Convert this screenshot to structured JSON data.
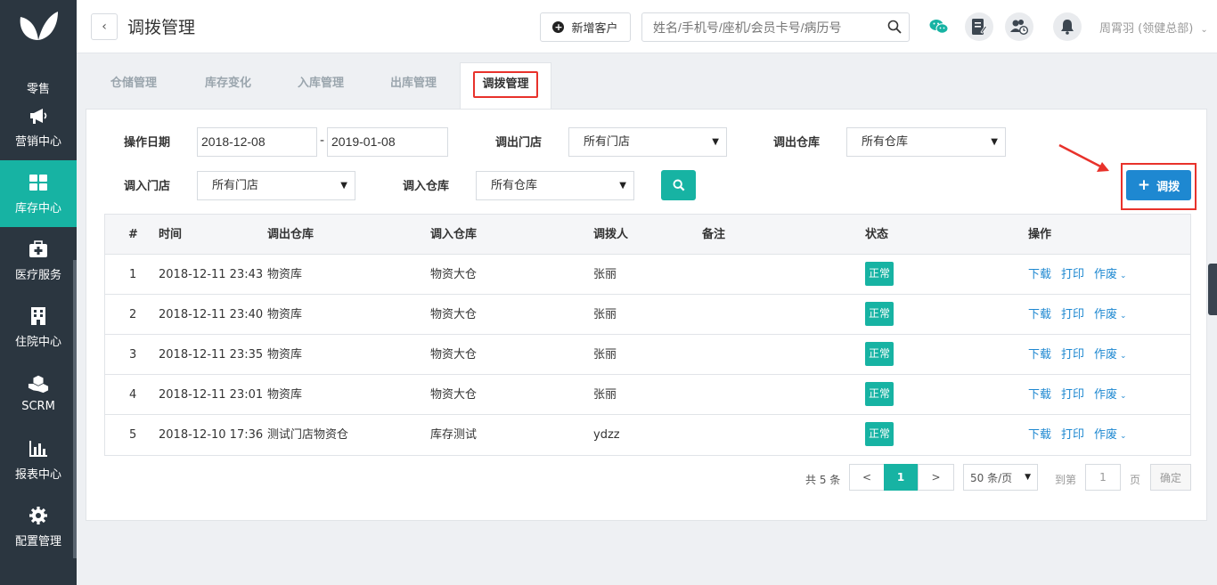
{
  "sidebar": {
    "items": [
      {
        "label": "零售",
        "icon": "butterfly-logo-icon"
      },
      {
        "label": "营销中心",
        "icon": "megaphone-icon"
      },
      {
        "label": "库存中心",
        "icon": "grid-icon"
      },
      {
        "label": "医疗服务",
        "icon": "medical-kit-icon"
      },
      {
        "label": "住院中心",
        "icon": "building-icon"
      },
      {
        "label": "SCRM",
        "icon": "cubes-icon"
      },
      {
        "label": "报表中心",
        "icon": "bar-chart-icon"
      },
      {
        "label": "配置管理",
        "icon": "gear-icon"
      }
    ],
    "active": "库存中心"
  },
  "header": {
    "title": "调拨管理",
    "new_customer": "新增客户",
    "search_placeholder": "姓名/手机号/座机/会员卡号/病历号",
    "user": "周霄羽 (领健总部)"
  },
  "tabs": [
    "仓储管理",
    "库存变化",
    "入库管理",
    "出库管理",
    "调拨管理"
  ],
  "filters": {
    "date_label": "操作日期",
    "date_from": "2018-12-08",
    "date_sep": "-",
    "date_to": "2019-01-08",
    "out_store_label": "调出门店",
    "out_store_value": "所有门店",
    "out_wh_label": "调出仓库",
    "out_wh_value": "所有仓库",
    "in_store_label": "调入门店",
    "in_store_value": "所有门店",
    "in_wh_label": "调入仓库",
    "in_wh_value": "所有仓库"
  },
  "add_button": "调拨",
  "table": {
    "headers": {
      "idx": "#",
      "time": "时间",
      "out_wh": "调出仓库",
      "in_wh": "调入仓库",
      "person": "调拨人",
      "note": "备注",
      "status": "状态",
      "ops": "操作"
    },
    "rows": [
      {
        "idx": "1",
        "time": "2018-12-11 23:43",
        "out_wh": "物资库",
        "in_wh": "物资大仓",
        "person": "张丽",
        "note": "",
        "status": "正常"
      },
      {
        "idx": "2",
        "time": "2018-12-11 23:40",
        "out_wh": "物资库",
        "in_wh": "物资大仓",
        "person": "张丽",
        "note": "",
        "status": "正常"
      },
      {
        "idx": "3",
        "time": "2018-12-11 23:35",
        "out_wh": "物资库",
        "in_wh": "物资大仓",
        "person": "张丽",
        "note": "",
        "status": "正常"
      },
      {
        "idx": "4",
        "time": "2018-12-11 23:01",
        "out_wh": "物资库",
        "in_wh": "物资大仓",
        "person": "张丽",
        "note": "",
        "status": "正常"
      },
      {
        "idx": "5",
        "time": "2018-12-10 17:36",
        "out_wh": "测试门店物资仓",
        "in_wh": "库存测试",
        "person": "ydzz",
        "note": "",
        "status": "正常"
      }
    ],
    "actions": {
      "download": "下载",
      "print": "打印",
      "void": "作废"
    }
  },
  "pagination": {
    "total": "共 5 条",
    "prev": "<",
    "current": "1",
    "next": ">",
    "page_size": "50 条/页",
    "goto_prefix": "到第",
    "goto_value": "1",
    "goto_suffix": "页",
    "confirm": "确定"
  },
  "colors": {
    "sidebar": "#2b3640",
    "accent": "#17b3a3",
    "primary": "#1e88d1",
    "highlight": "#e8322b"
  }
}
